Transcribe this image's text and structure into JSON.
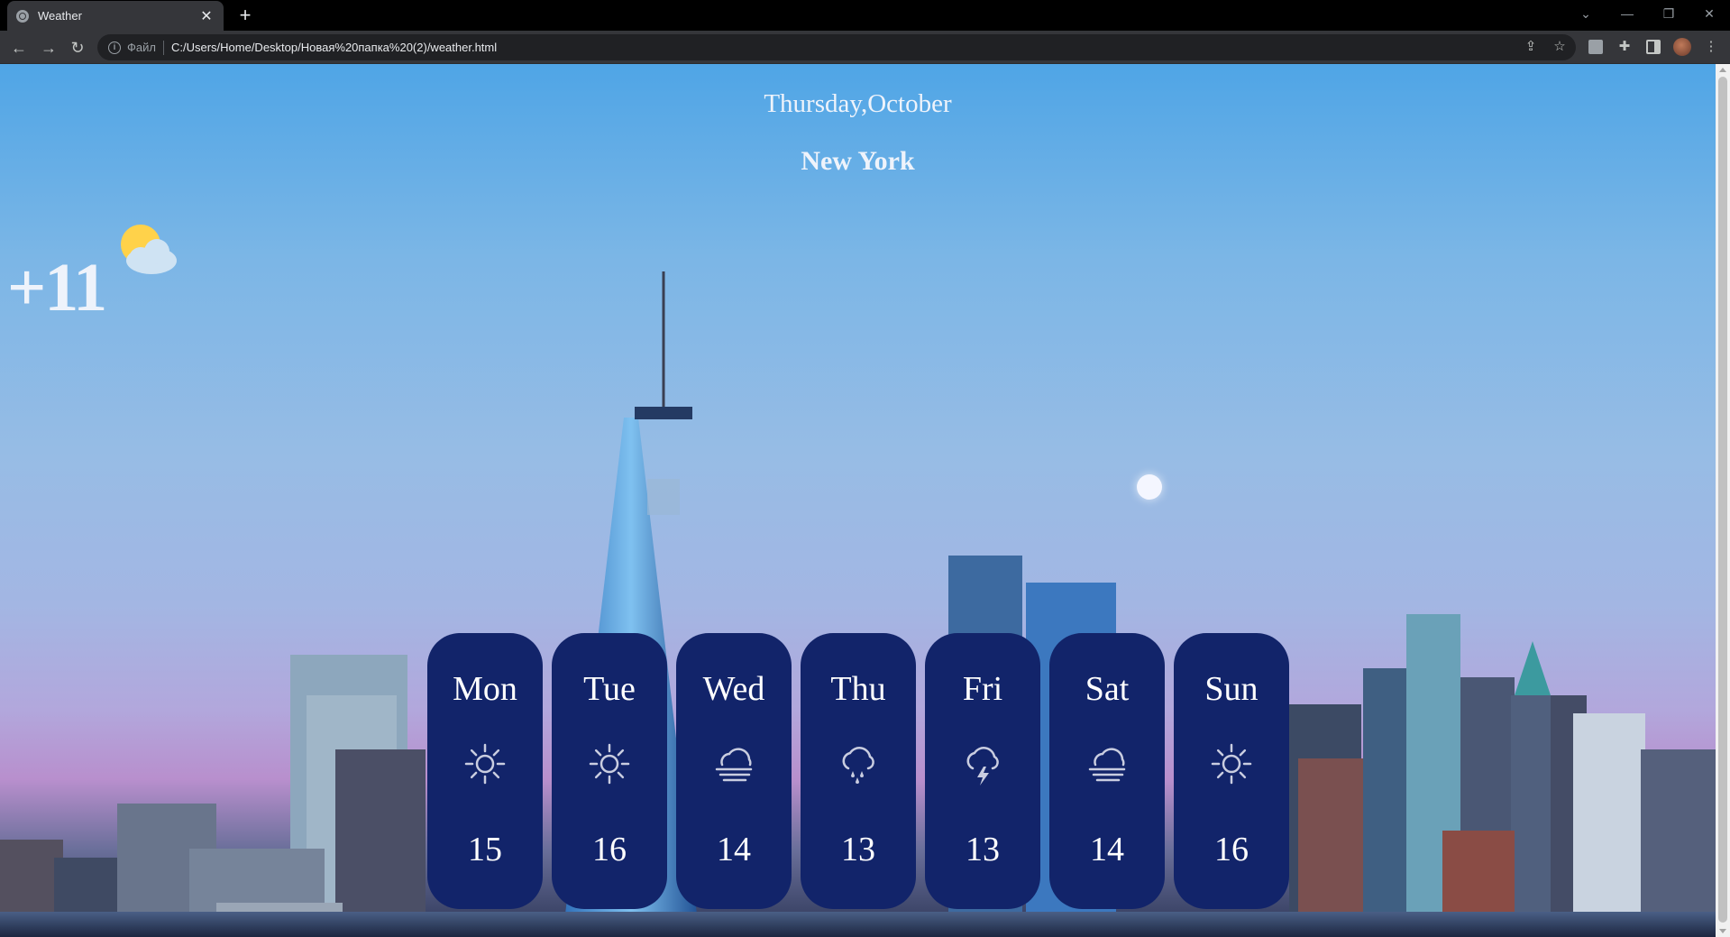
{
  "browser": {
    "tab_title": "Weather",
    "tab_close": "✕",
    "new_tab": "+",
    "scheme_label": "Файл",
    "url": "C:/Users/Home/Desktop/Новая%20папка%20(2)/weather.html"
  },
  "page": {
    "date": "Thursday,October",
    "city": "New York",
    "current_temp": "+11",
    "current_icon": "sun-behind-cloud-icon"
  },
  "forecast": [
    {
      "day": "Mon",
      "temp": "15",
      "icon": "sun-icon"
    },
    {
      "day": "Tue",
      "temp": "16",
      "icon": "sun-icon"
    },
    {
      "day": "Wed",
      "temp": "14",
      "icon": "fog-icon"
    },
    {
      "day": "Thu",
      "temp": "13",
      "icon": "rain-icon"
    },
    {
      "day": "Fri",
      "temp": "13",
      "icon": "thunderstorm-icon"
    },
    {
      "day": "Sat",
      "temp": "14",
      "icon": "fog-icon"
    },
    {
      "day": "Sun",
      "temp": "16",
      "icon": "sun-icon"
    }
  ],
  "colors": {
    "card": "#12246a",
    "text": "#eef3fb"
  }
}
